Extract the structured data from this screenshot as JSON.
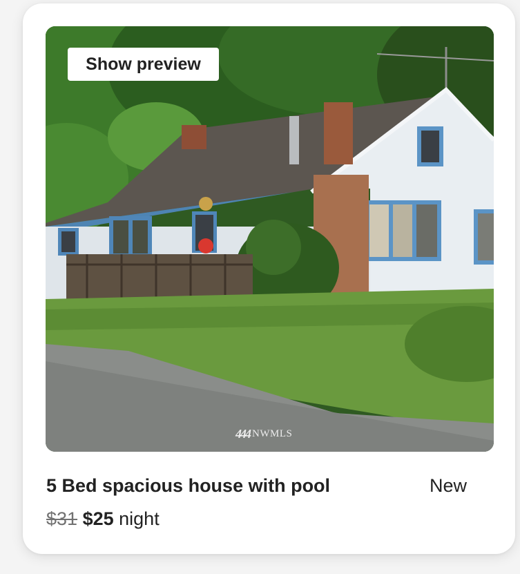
{
  "listing": {
    "preview_button": "Show preview",
    "watermark": "NWMLS",
    "watermark_mark": "444",
    "title": "5 Bed spacious house with pool",
    "badge": "New",
    "original_price": "$31",
    "price": "$25",
    "price_unit": "night"
  },
  "colors": {
    "text": "#222222",
    "strike_price": "#717171",
    "card_bg": "#ffffff"
  }
}
